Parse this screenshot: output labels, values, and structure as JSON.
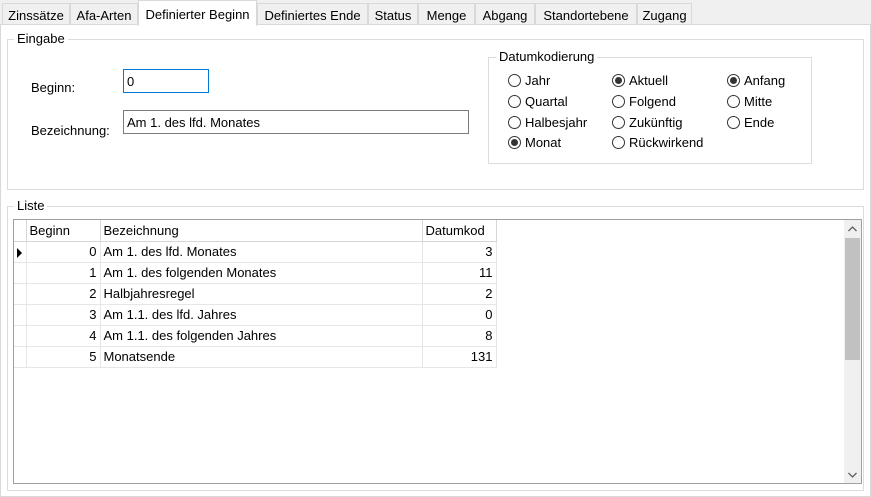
{
  "tabs": [
    {
      "label": "Zinssätze",
      "active": false
    },
    {
      "label": "Afa-Arten",
      "active": false
    },
    {
      "label": "Definierter Beginn",
      "active": true
    },
    {
      "label": "Definiertes Ende",
      "active": false
    },
    {
      "label": "Status",
      "active": false
    },
    {
      "label": "Menge",
      "active": false
    },
    {
      "label": "Abgang",
      "active": false
    },
    {
      "label": "Standortebene",
      "active": false
    },
    {
      "label": "Zugang",
      "active": false
    }
  ],
  "eingabe": {
    "legend": "Eingabe",
    "beginn_label": "Beginn:",
    "beginn_value": "0",
    "bezeichnung_label": "Bezeichnung:",
    "bezeichnung_value": "Am 1. des lfd. Monates"
  },
  "datumkodierung": {
    "legend": "Datumkodierung",
    "period": [
      {
        "label": "Jahr",
        "checked": false
      },
      {
        "label": "Quartal",
        "checked": false
      },
      {
        "label": "Halbesjahr",
        "checked": false
      },
      {
        "label": "Monat",
        "checked": true
      }
    ],
    "timing": [
      {
        "label": "Aktuell",
        "checked": true
      },
      {
        "label": "Folgend",
        "checked": false
      },
      {
        "label": "Zukünftig",
        "checked": false
      },
      {
        "label": "Rückwirkend",
        "checked": false
      }
    ],
    "position": [
      {
        "label": "Anfang",
        "checked": true
      },
      {
        "label": "Mitte",
        "checked": false
      },
      {
        "label": "Ende",
        "checked": false
      }
    ]
  },
  "liste": {
    "legend": "Liste",
    "columns": [
      "Beginn",
      "Bezeichnung",
      "Datumkod"
    ],
    "rows": [
      {
        "beginn": "0",
        "bezeichnung": "Am 1. des lfd. Monates",
        "datumkod": "3",
        "current": true
      },
      {
        "beginn": "1",
        "bezeichnung": "Am 1. des folgenden Monates",
        "datumkod": "11",
        "current": false
      },
      {
        "beginn": "2",
        "bezeichnung": "Halbjahresregel",
        "datumkod": "2",
        "current": false
      },
      {
        "beginn": "3",
        "bezeichnung": "Am 1.1. des lfd. Jahres",
        "datumkod": "0",
        "current": false
      },
      {
        "beginn": "4",
        "bezeichnung": "Am 1.1. des folgenden Jahres",
        "datumkod": "8",
        "current": false
      },
      {
        "beginn": "5",
        "bezeichnung": "Monatsende",
        "datumkod": "131",
        "current": false
      }
    ]
  },
  "icons": {
    "scroll_up": "chevron-up-icon",
    "scroll_down": "chevron-down-icon",
    "current_row": "row-pointer-icon"
  },
  "colors": {
    "focus_border": "#0078d7",
    "window_bg": "#f0f0f0",
    "page_bg": "#ffffff"
  }
}
